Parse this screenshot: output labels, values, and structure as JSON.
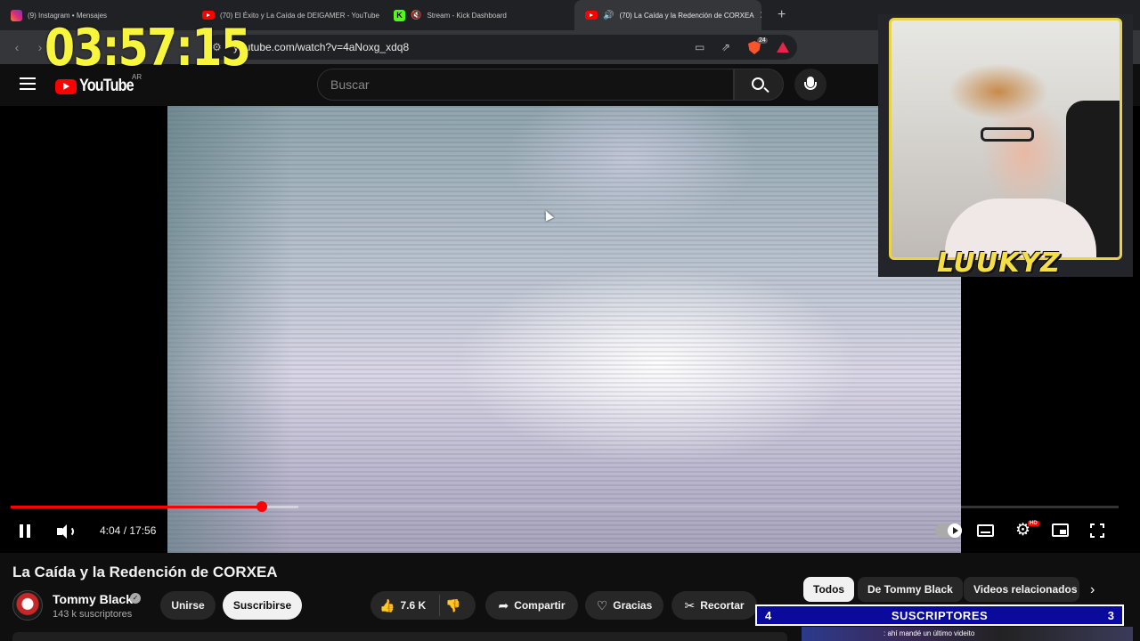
{
  "browser": {
    "tabs": [
      {
        "title": "(9) Instagram • Mensajes",
        "favicon": "instagram-icon"
      },
      {
        "title": "(70) El Éxito y La Caída de DEIGAMER - YouTube",
        "favicon": "youtube-icon"
      },
      {
        "title": "Stream - Kick Dashboard",
        "favicon": "kick-icon",
        "muted": true
      },
      {
        "title": "(70) La Caída y la Redención de CORXEA",
        "favicon": "youtube-icon",
        "active": true,
        "audio": true
      }
    ],
    "url": "youtube.com/watch?v=4aNoxg_xdq8",
    "brave_badge": "24"
  },
  "stream_overlay": {
    "timer": "03:57:15",
    "streamer_name": "LUUKYZ",
    "goal": {
      "current": "4",
      "label": "SUSCRIPTORES",
      "target": "3"
    },
    "ticker_text": ": ahí mandé un último videito"
  },
  "youtube": {
    "logo_text": "YouTube",
    "country_code": "AR",
    "search_placeholder": "Buscar",
    "player": {
      "current_time": "4:04",
      "duration": "17:56",
      "time_display": "4:04 / 17:56",
      "played_fraction": 0.227,
      "buffered_fraction": 0.26,
      "hd_badge": "HD"
    },
    "video_title": "La Caída y la Redención de CORXEA",
    "channel": {
      "name": "Tommy Black",
      "subscribers": "143 k suscriptores",
      "verified": true
    },
    "actions": {
      "join": "Unirse",
      "subscribe": "Suscribirse",
      "likes": "7.6 K",
      "share": "Compartir",
      "thanks": "Gracias",
      "clip": "Recortar"
    },
    "chips": [
      "Todos",
      "De Tommy Black",
      "Videos relacionados"
    ]
  },
  "colors": {
    "timer": "#f7f63c",
    "streamer_name": "#f5df45",
    "progress": "#ff0000",
    "goal_bg": "#0a0a9c"
  }
}
